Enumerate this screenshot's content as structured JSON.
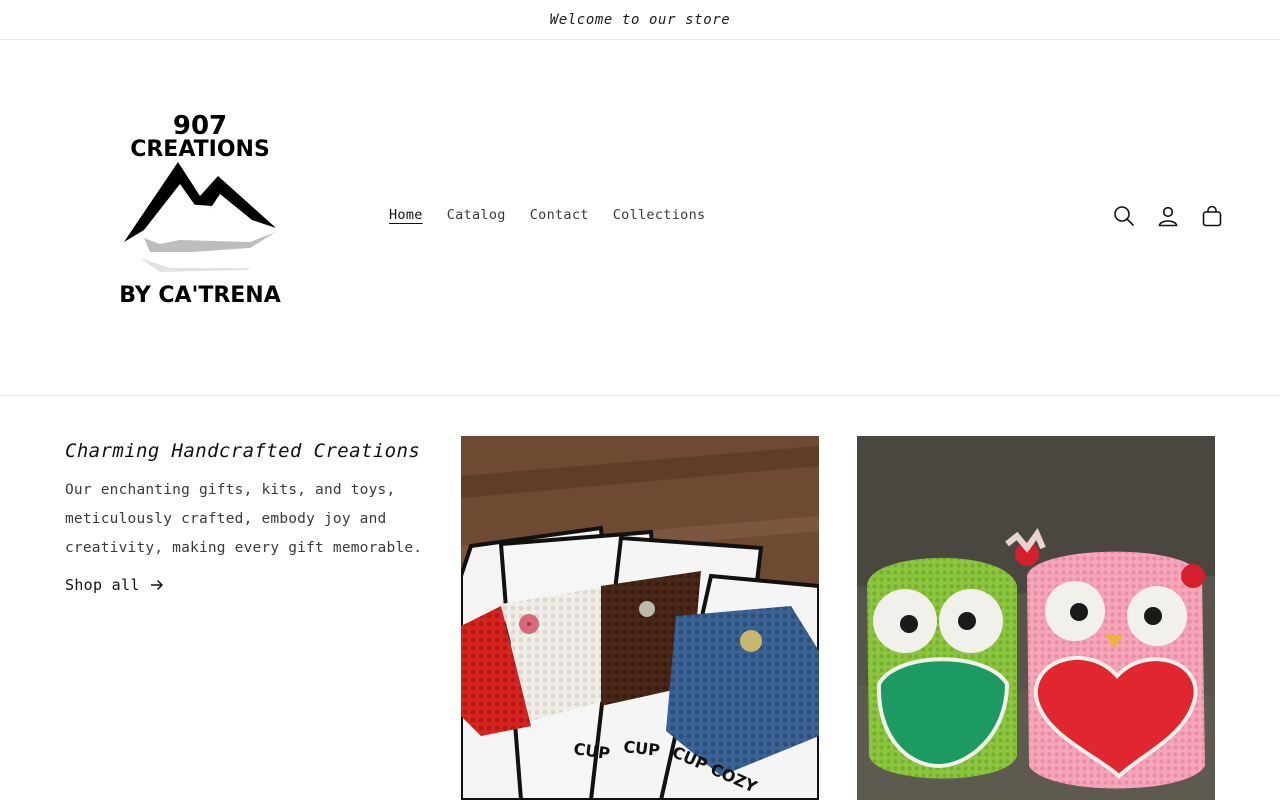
{
  "announcement": {
    "text": "Welcome to our store"
  },
  "logo": {
    "line1": "907",
    "line2": "CREATIONS",
    "line3": "BY CA'TRENA"
  },
  "nav": {
    "items": [
      {
        "label": "Home",
        "active": true
      },
      {
        "label": "Catalog",
        "active": false
      },
      {
        "label": "Contact",
        "active": false
      },
      {
        "label": "Collections",
        "active": false
      }
    ]
  },
  "header_icons": {
    "search": "search-icon",
    "account": "account-icon",
    "cart": "cart-icon"
  },
  "hero": {
    "title": "Charming Handcrafted Creations",
    "description": "Our enchanting gifts, kits, and toys, meticulously crafted, embody joy and creativity, making every gift memorable.",
    "cta_label": "Shop all"
  },
  "cards": {
    "card1": {
      "sleeve_label_a": "CUP",
      "sleeve_label_b": "CUP",
      "sleeve_label_c": "CUP COZY"
    }
  },
  "colors": {
    "text": "#121212",
    "muted": "#3a3a3a",
    "border": "#e6e6e6",
    "background": "#ffffff"
  }
}
